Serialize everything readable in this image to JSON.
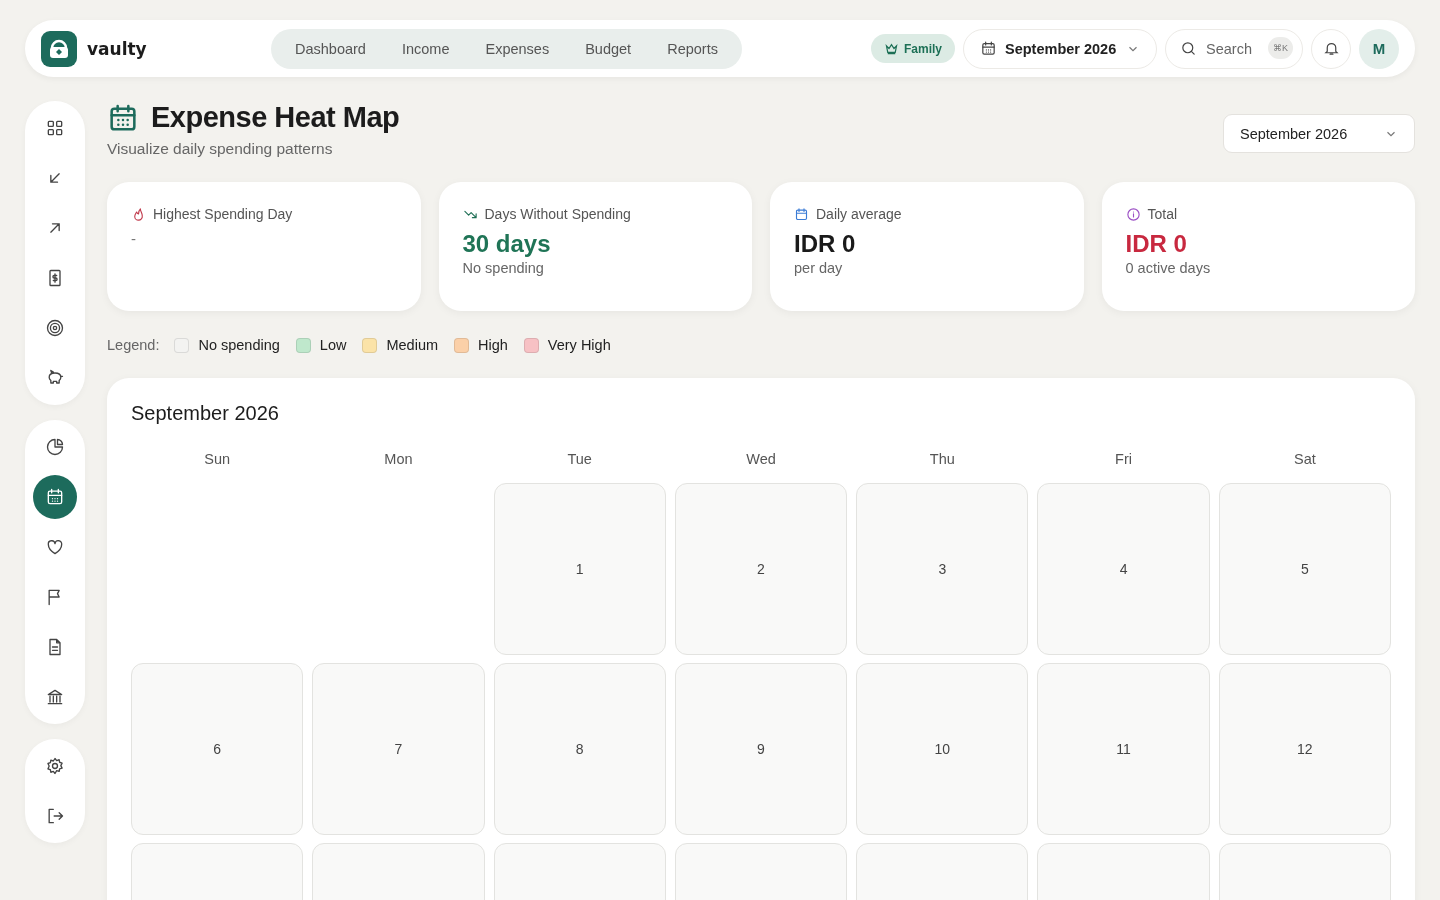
{
  "brand": {
    "name": "vaulty"
  },
  "nav": [
    {
      "label": "Dashboard",
      "selected": false
    },
    {
      "label": "Income",
      "selected": false
    },
    {
      "label": "Expenses",
      "selected": false
    },
    {
      "label": "Budget",
      "selected": false
    },
    {
      "label": "Reports",
      "selected": false
    }
  ],
  "plan_badge": "Family",
  "period_picker": "September 2026",
  "search": {
    "placeholder": "Search",
    "shortcut": "⌘K"
  },
  "avatar": "M",
  "sidebar": [
    [
      {
        "selected": false
      },
      {
        "selected": false
      },
      {
        "selected": false
      },
      {
        "selected": false
      },
      {
        "selected": false
      },
      {
        "selected": false
      }
    ],
    [
      {
        "selected": false
      },
      {
        "selected": true
      },
      {
        "selected": false
      },
      {
        "selected": false
      },
      {
        "selected": false
      },
      {
        "selected": false
      }
    ],
    [
      {
        "selected": false
      },
      {
        "selected": false
      }
    ]
  ],
  "page": {
    "title": "Expense Heat Map",
    "subtitle": "Visualize daily spending patterns",
    "month_select": "September 2026"
  },
  "stats": [
    {
      "label": "Highest Spending Day",
      "value": "-",
      "kind": "muted"
    },
    {
      "label": "Days Without Spending",
      "value": "30 days",
      "note": "No spending",
      "kind": "positive"
    },
    {
      "label": "Daily average",
      "value": "IDR 0",
      "note": "per day",
      "kind": "neutral"
    },
    {
      "label": "Total",
      "value": "IDR 0",
      "note": "0 active days",
      "kind": "negative"
    }
  ],
  "legend": {
    "label": "Legend:",
    "items": [
      {
        "label": "No spending",
        "color": "#f3f3f1"
      },
      {
        "label": "Low",
        "color": "#bfe8cc"
      },
      {
        "label": "Medium",
        "color": "#fbe3a8"
      },
      {
        "label": "High",
        "color": "#fbd0a8"
      },
      {
        "label": "Very High",
        "color": "#f7c1c4"
      }
    ]
  },
  "calendar": {
    "title": "September 2026",
    "weekdays": [
      "Sun",
      "Mon",
      "Tue",
      "Wed",
      "Thu",
      "Fri",
      "Sat"
    ],
    "weeks": [
      [
        {
          "kind": "blank"
        },
        {
          "kind": "blank"
        },
        {
          "kind": "day",
          "day": "1",
          "color": "#f9f9f8"
        },
        {
          "kind": "day",
          "day": "2",
          "color": "#f9f9f8"
        },
        {
          "kind": "day",
          "day": "3",
          "color": "#f9f9f8"
        },
        {
          "kind": "day",
          "day": "4",
          "color": "#f9f9f8"
        },
        {
          "kind": "day",
          "day": "5",
          "color": "#f9f9f8"
        }
      ],
      [
        {
          "kind": "day",
          "day": "6",
          "color": "#f9f9f8"
        },
        {
          "kind": "day",
          "day": "7",
          "color": "#f9f9f8"
        },
        {
          "kind": "day",
          "day": "8",
          "color": "#f9f9f8"
        },
        {
          "kind": "day",
          "day": "9",
          "color": "#f9f9f8"
        },
        {
          "kind": "day",
          "day": "10",
          "color": "#f9f9f8"
        },
        {
          "kind": "day",
          "day": "11",
          "color": "#f9f9f8"
        },
        {
          "kind": "day",
          "day": "12",
          "color": "#f9f9f8"
        }
      ],
      [
        {
          "kind": "day",
          "color": "#f9f9f8"
        },
        {
          "kind": "day",
          "color": "#f9f9f8"
        },
        {
          "kind": "day",
          "color": "#f9f9f8"
        },
        {
          "kind": "day",
          "color": "#f9f9f8"
        },
        {
          "kind": "day",
          "color": "#f9f9f8"
        },
        {
          "kind": "day",
          "color": "#f9f9f8"
        },
        {
          "kind": "day",
          "color": "#f9f9f8"
        }
      ]
    ]
  }
}
